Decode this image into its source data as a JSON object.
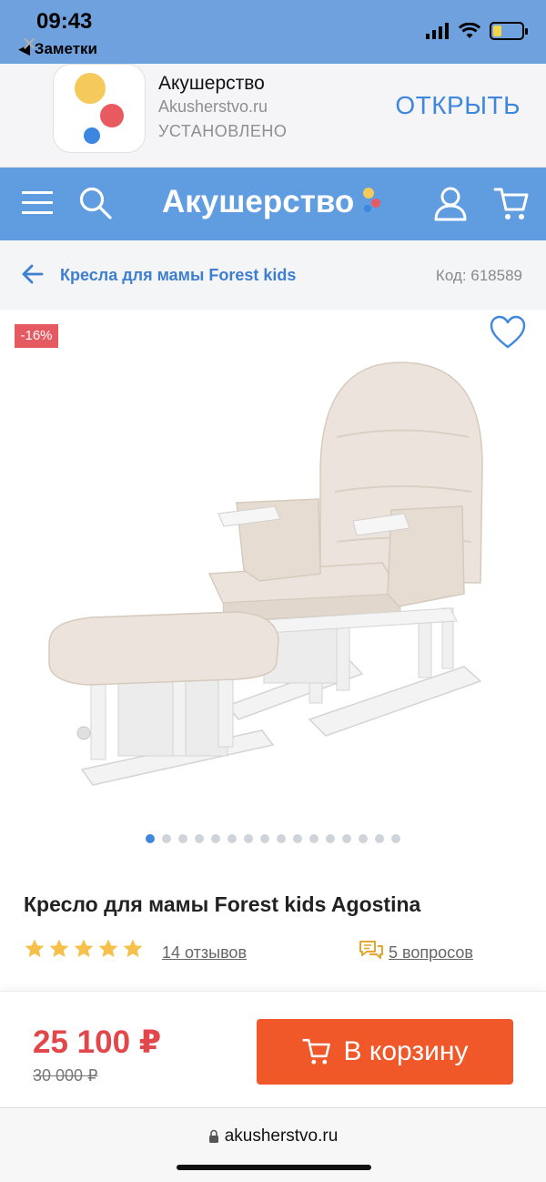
{
  "status_bar": {
    "time": "09:43",
    "back_app": "◀ Заметки",
    "battery_fraction": 0.3,
    "battery_color": "#f2d54c"
  },
  "app_banner": {
    "app_name": "Акушерство",
    "app_url": "Akusherstvo.ru",
    "install_status": "УСТАНОВЛЕНО",
    "open_label": "ОТКРЫТЬ"
  },
  "header": {
    "brand": "Акушерство",
    "icons": [
      "menu-icon",
      "search-icon",
      "user-icon",
      "cart-icon"
    ],
    "color": "#5f9ce0"
  },
  "breadcrumb": {
    "category": "Кресла для мамы Forest kids",
    "code_label": "Код: 618589"
  },
  "product": {
    "discount": "-16%",
    "title": "Кресло для мамы Forest kids Agostina",
    "rating_stars": 5,
    "reviews": "14 отзывов",
    "questions": "5 вопросов",
    "gallery_count": 16,
    "gallery_active": 0
  },
  "purchase": {
    "price": "25 100 ₽",
    "old_price": "30 000 ₽",
    "cart_label": "В корзину",
    "price_color": "#e2474c",
    "button_color": "#f0582a"
  },
  "browser": {
    "url": "akusherstvo.ru"
  }
}
